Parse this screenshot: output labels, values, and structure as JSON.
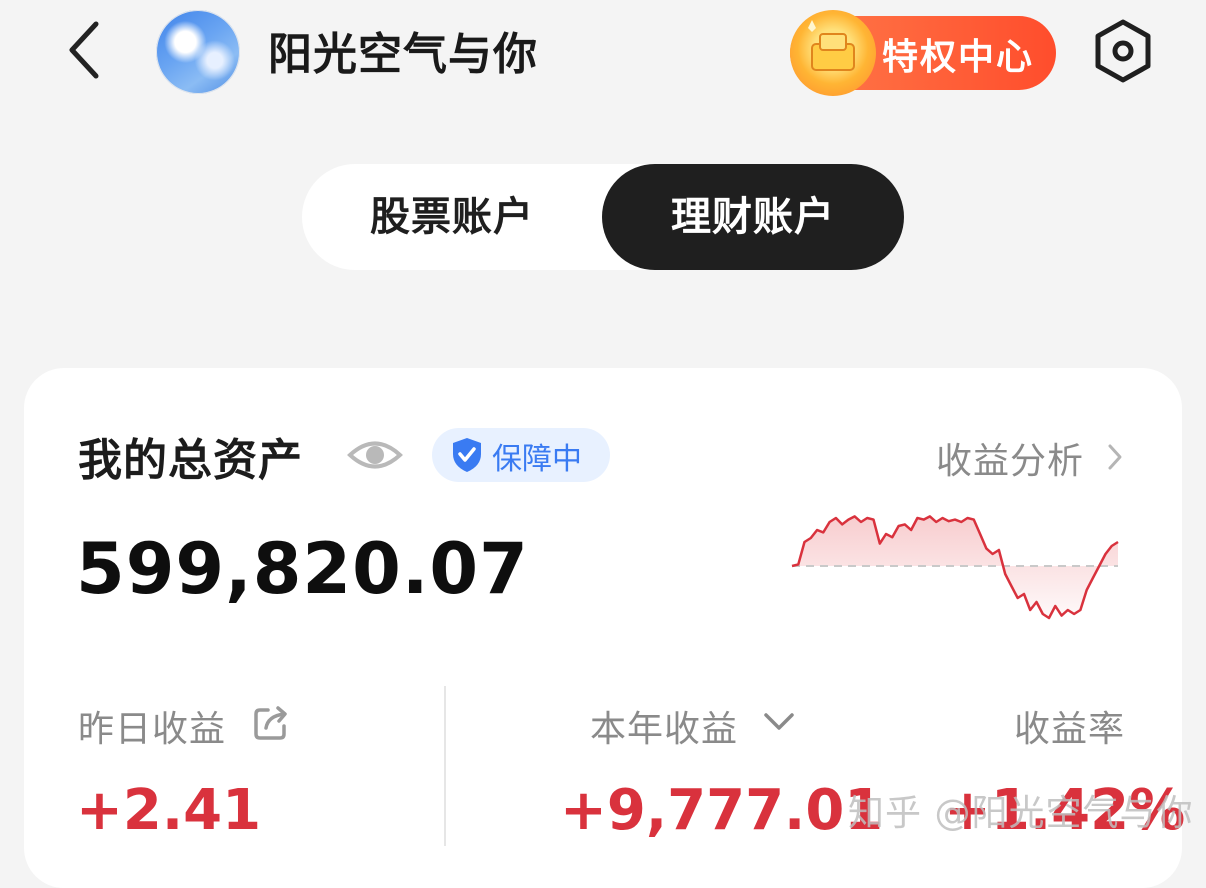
{
  "header": {
    "back_icon": "chevron-left-icon",
    "username": "阳光空气与你",
    "privilege_label": "特权中心",
    "privilege_icon": "gift-gold-icon",
    "settings_icon": "hexagon-settings-icon"
  },
  "tabs": [
    {
      "label": "股票账户",
      "active": false
    },
    {
      "label": "理财账户",
      "active": true
    }
  ],
  "card": {
    "title": "我的总资产",
    "eye_icon": "eye-icon",
    "badge": "保障中",
    "badge_icon": "shield-check-icon",
    "analysis_link": "收益分析",
    "total_value": "599,820.07",
    "stats": {
      "yesterday": {
        "label": "昨日收益",
        "value": "+2.41",
        "icon": "share-icon"
      },
      "year": {
        "label": "本年收益",
        "value": "+9,777.01",
        "icon": "chevron-down-icon"
      },
      "rate": {
        "label": "收益率",
        "value": "+1.42%"
      }
    }
  },
  "sparkline": {
    "type": "line",
    "values": [
      0.0,
      0.02,
      0.3,
      0.35,
      0.45,
      0.42,
      0.55,
      0.6,
      0.52,
      0.58,
      0.62,
      0.55,
      0.6,
      0.58,
      0.28,
      0.4,
      0.36,
      0.5,
      0.52,
      0.45,
      0.6,
      0.58,
      0.62,
      0.55,
      0.6,
      0.56,
      0.58,
      0.55,
      0.6,
      0.58,
      0.4,
      0.22,
      0.15,
      0.2,
      -0.1,
      -0.25,
      -0.4,
      -0.35,
      -0.55,
      -0.45,
      -0.6,
      -0.65,
      -0.5,
      -0.62,
      -0.55,
      -0.6,
      -0.55,
      -0.3,
      -0.15,
      0.0,
      0.15,
      0.25,
      0.3
    ],
    "baseline": 0,
    "line_color": "#d9323d",
    "fill_color": "#f7c7c9"
  },
  "watermark": "知乎 @阳光空气与你",
  "colors": {
    "gain": "#d9323d",
    "accent_blue": "#3a7bf2",
    "privilege": "#ff5a34"
  }
}
